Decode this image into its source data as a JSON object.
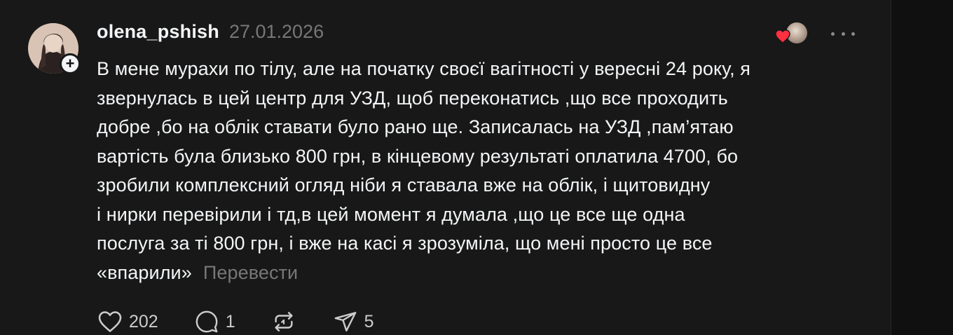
{
  "post": {
    "username": "olena_pshish",
    "timestamp": "27.01.2026",
    "body_lines": [
      "В мене мурахи по тілу, але на початку своєї вагітності у вересні 24 року, я",
      "звернулась в цей центр для УЗД, щоб переконатись ,що все проходить",
      "добре ,бо на облік ставати було рано ще. Записалась на УЗД ,пам’ятаю",
      "вартість була близько 800 грн, в кінцевому результаті оплатила 4700, бо",
      "зробили комплексний огляд ніби я ставала вже на облік, і щитовидну",
      "і нирки перевірили і тд,в цей момент я думала ,що це все ще одна",
      "послуга за ті 800 грн, і вже на касі я зрозуміла, що мені просто це все",
      "«впарили»"
    ],
    "translate_label": "Перевести",
    "follow_badge": "+",
    "actions": {
      "likes": "202",
      "replies": "1",
      "shares": "5"
    }
  },
  "colors": {
    "background": "#181818",
    "text": "#f3f5f7",
    "muted": "#777777",
    "heart": "#ff3040"
  },
  "icons": [
    "heart-icon",
    "comment-icon",
    "repost-icon",
    "share-icon",
    "more-icon",
    "plus-icon"
  ]
}
